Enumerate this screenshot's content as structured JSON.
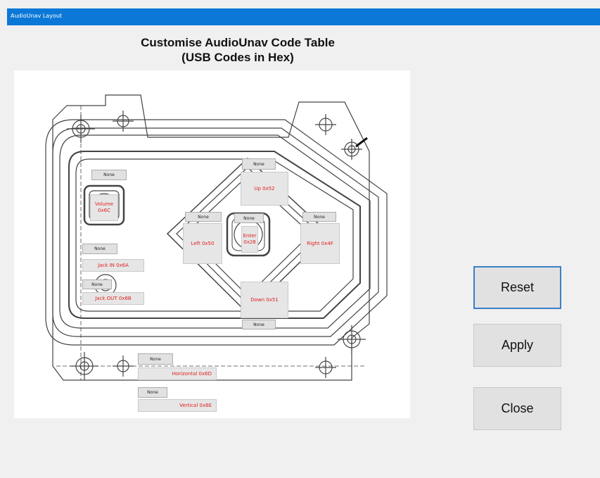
{
  "window": {
    "title": "AudioUnav Layout"
  },
  "heading": {
    "line1": "Customise AudioUnav Code Table",
    "line2": "(USB Codes in Hex)"
  },
  "codes": {
    "volume": {
      "slot": "None",
      "label": "Volume 0x6C"
    },
    "up": {
      "slot": "None",
      "label": "Up 0x52"
    },
    "left": {
      "slot": "None",
      "label": "Left 0x50"
    },
    "enter": {
      "slot": "None",
      "label": "Enter 0x28"
    },
    "right": {
      "slot": "None",
      "label": "Right 0x4F"
    },
    "down": {
      "slot": "None",
      "label": "Down 0x51"
    },
    "jack_in": {
      "slot": "None",
      "label": "Jack IN 0x6A"
    },
    "jack_out": {
      "slot": "None",
      "label": "Jack OUT 0x6B"
    },
    "horizontal": {
      "slot": "None",
      "label": "Horizontal 0x6D"
    },
    "vertical": {
      "slot": "None",
      "label": "Vertical 0x6E"
    }
  },
  "buttons": {
    "reset": "Reset",
    "apply": "Apply",
    "close": "Close"
  },
  "colors": {
    "titlebar": "#0b78d7",
    "code_text": "#e02020",
    "focus_border": "#3b7fc8"
  }
}
